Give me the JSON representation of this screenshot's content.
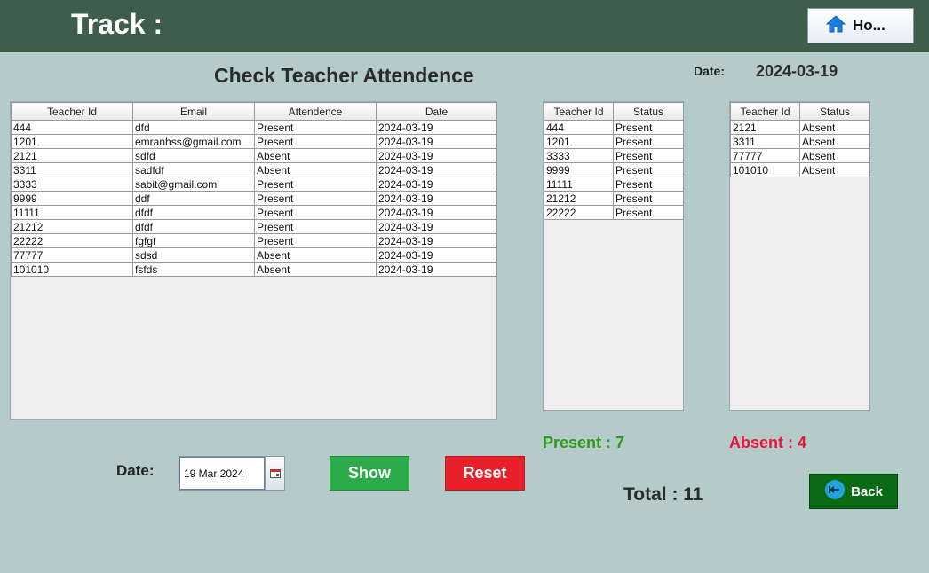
{
  "header": {
    "title": "Track :",
    "home_label": "Ho...",
    "home_icon": "home-icon"
  },
  "page": {
    "title": "Check Teacher Attendence",
    "date_label": "Date:",
    "date_value": "2024-03-19"
  },
  "main_table": {
    "columns": [
      "Teacher Id",
      "Email",
      "Attendence",
      "Date"
    ],
    "rows": [
      [
        "444",
        "dfd",
        "Present",
        "2024-03-19"
      ],
      [
        "1201",
        "emranhss@gmail.com",
        "Present",
        "2024-03-19"
      ],
      [
        "2121",
        "sdfd",
        "Absent",
        "2024-03-19"
      ],
      [
        "3311",
        "sadfdf",
        "Absent",
        "2024-03-19"
      ],
      [
        "3333",
        "sabit@gmail.com",
        "Present",
        "2024-03-19"
      ],
      [
        "9999",
        "ddf",
        "Present",
        "2024-03-19"
      ],
      [
        "11111",
        "dfdf",
        "Present",
        "2024-03-19"
      ],
      [
        "21212",
        "dfdf",
        "Present",
        "2024-03-19"
      ],
      [
        "22222",
        "fgfgf",
        "Present",
        "2024-03-19"
      ],
      [
        "77777",
        "sdsd",
        "Absent",
        "2024-03-19"
      ],
      [
        "101010",
        "fsfds",
        "Absent",
        "2024-03-19"
      ]
    ]
  },
  "present_table": {
    "columns": [
      "Teacher Id",
      "Status"
    ],
    "rows": [
      [
        "444",
        "Present"
      ],
      [
        "1201",
        "Present"
      ],
      [
        "3333",
        "Present"
      ],
      [
        "9999",
        "Present"
      ],
      [
        "11111",
        "Present"
      ],
      [
        "21212",
        "Present"
      ],
      [
        "22222",
        "Present"
      ]
    ]
  },
  "absent_table": {
    "columns": [
      "Teacher Id",
      "Status"
    ],
    "rows": [
      [
        "2121",
        "Absent"
      ],
      [
        "3311",
        "Absent"
      ],
      [
        "77777",
        "Absent"
      ],
      [
        "101010",
        "Absent"
      ]
    ]
  },
  "summary": {
    "present": "Present : 7",
    "absent": "Absent : 4",
    "total": "Total : 11"
  },
  "controls": {
    "date_label": "Date:",
    "date_value": "19 Mar 2024",
    "calendar_icon": "calendar-icon",
    "show_label": "Show",
    "reset_label": "Reset",
    "back_label": "Back",
    "back_icon": "back-arrow-icon"
  },
  "colors": {
    "header_bg": "#3e5d4b",
    "page_bg": "#b4cbca",
    "present": "#2e9a1c",
    "absent": "#e8163a",
    "show_btn": "#2bab49",
    "reset_btn": "#e8202a",
    "back_btn": "#0b6b15"
  }
}
